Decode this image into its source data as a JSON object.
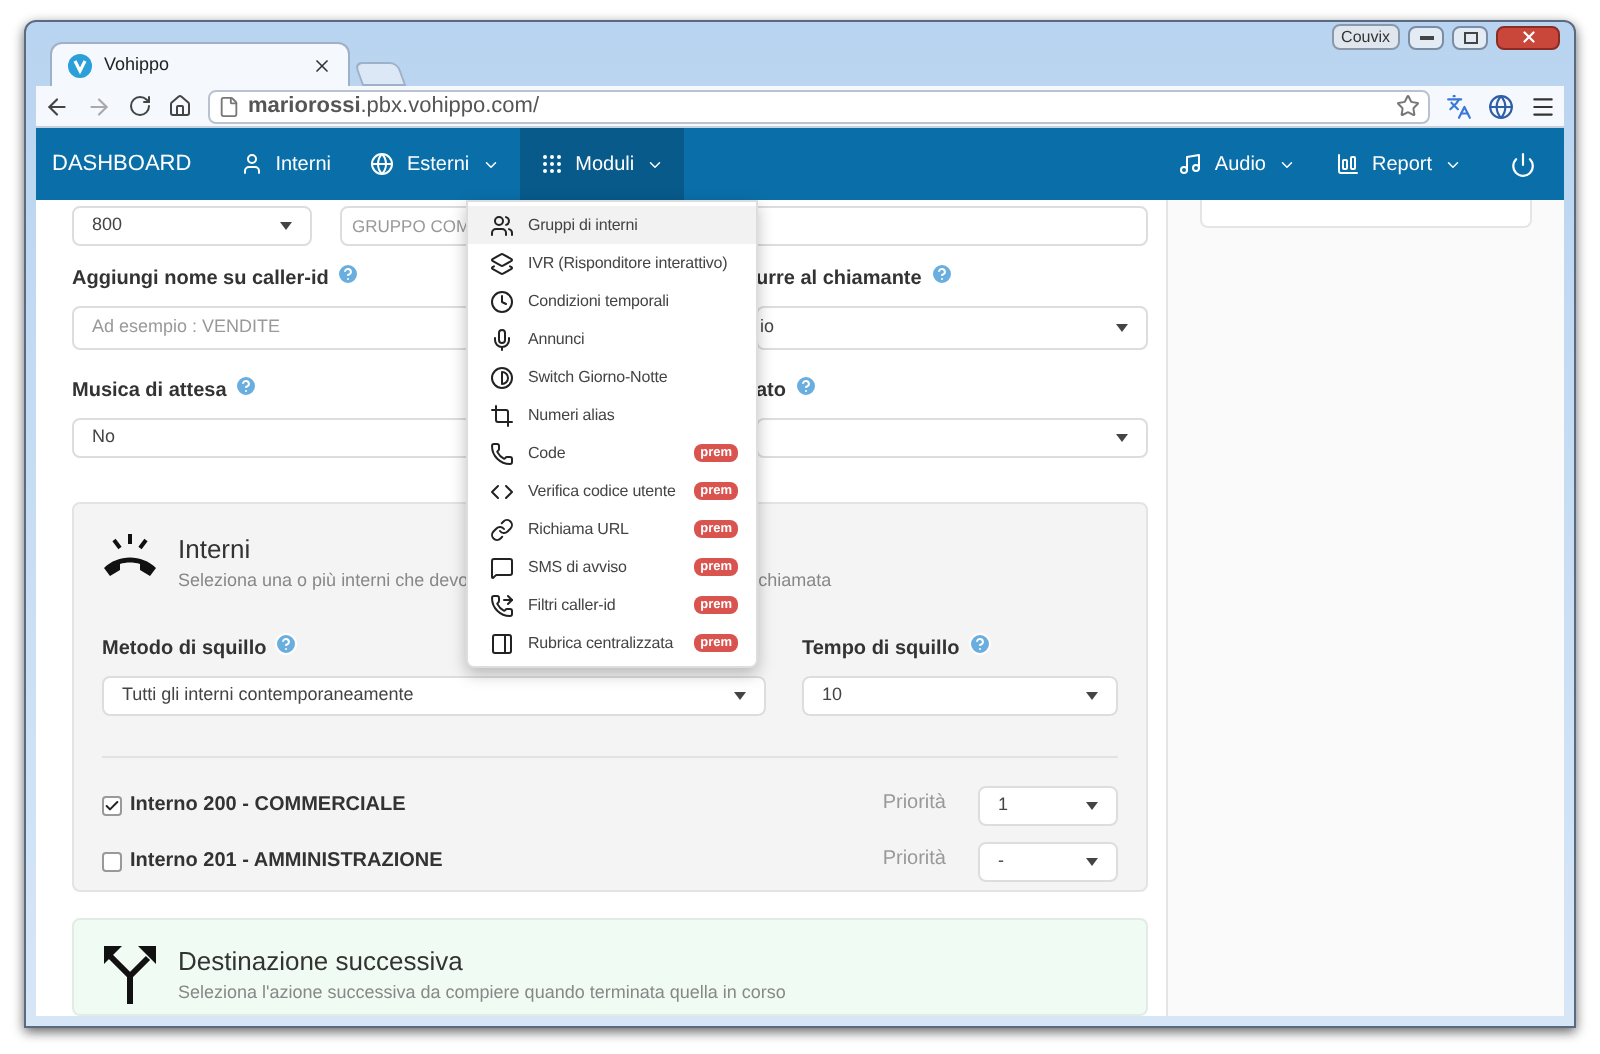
{
  "browser": {
    "tab_title": "Vohippo",
    "profile": "Couvix",
    "url": "**mariorossi**.pbx.vohippo.com/"
  },
  "navbar": {
    "brand": "DASHBOARD",
    "items": [
      {
        "label": "Interni",
        "kind": "user",
        "caret": false,
        "selected": false
      },
      {
        "label": "Esterni",
        "kind": "globe",
        "caret": true,
        "selected": false
      },
      {
        "label": "Moduli",
        "kind": "grid",
        "caret": true,
        "selected": true
      }
    ],
    "right_items": [
      {
        "label": "Audio",
        "kind": "music",
        "caret": true
      },
      {
        "label": "Report",
        "kind": "chart",
        "caret": true
      }
    ]
  },
  "menu": {
    "items": [
      {
        "label": "Gruppi di interni",
        "kind": "users",
        "highlighted": true
      },
      {
        "label": "IVR (Risponditore interattivo)",
        "kind": "stack",
        "highlighted": false
      },
      {
        "label": "Condizioni temporali",
        "kind": "clock",
        "highlighted": false
      },
      {
        "label": "Annunci",
        "kind": "mic",
        "highlighted": false
      },
      {
        "label": "Switch Giorno-Notte",
        "kind": "contrast",
        "highlighted": false
      },
      {
        "label": "Numeri alias",
        "kind": "crop",
        "highlighted": false
      },
      {
        "label": "Code",
        "kind": "phone",
        "badge": "prem",
        "highlighted": false
      },
      {
        "label": "Verifica codice utente",
        "kind": "code",
        "badge": "prem",
        "highlighted": false
      },
      {
        "label": "Richiama URL",
        "kind": "link",
        "badge": "prem",
        "highlighted": false
      },
      {
        "label": "SMS di avviso",
        "kind": "message",
        "badge": "prem",
        "highlighted": false
      },
      {
        "label": "Filtri caller-id",
        "kind": "forward",
        "badge": "prem",
        "highlighted": false
      },
      {
        "label": "Rubrica centralizzata",
        "kind": "panel",
        "badge": "prem",
        "highlighted": false
      }
    ]
  },
  "form": {
    "number_select": "800",
    "group_name": "GRUPPO COM",
    "caller_label": "Aggiungi nome su caller-id",
    "caller_placeholder": "Ad esempio : VENDITE",
    "column_2_label_a": "urre al chiamante",
    "column_2_value_a": "io",
    "music_label": "Musica di attesa",
    "music_value": "No",
    "column_2_label_b": "ato"
  },
  "interni_card": {
    "title": "Interni",
    "subtitle_start": "Seleziona una o più interni che devo",
    "subtitle_end": "chiamata",
    "ring_method_label": "Metodo di squillo",
    "ring_method_value": "Tutti gli interni contemporaneamente",
    "ring_time_label": "Tempo di squillo",
    "ring_time_value": "10",
    "extensions": [
      {
        "label": "Interno 200 - COMMERCIALE",
        "checked": true,
        "priority_label": "Priorità",
        "priority": "1"
      },
      {
        "label": "Interno 201 - AMMINISTRAZIONE",
        "checked": false,
        "priority_label": "Priorità",
        "priority": "-"
      }
    ]
  },
  "next_card": {
    "title": "Destinazione successiva",
    "subtitle": "Seleziona l'azione successiva da compiere quando terminata quella in corso"
  }
}
